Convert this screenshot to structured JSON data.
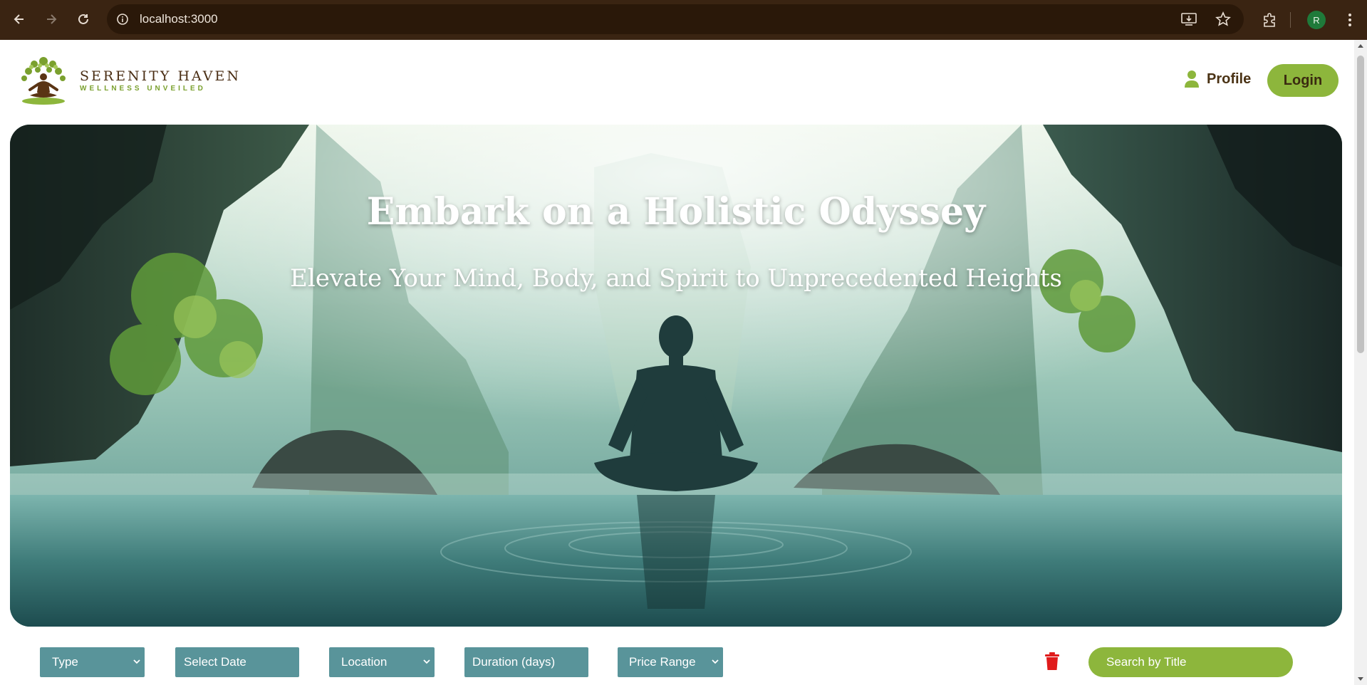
{
  "browser": {
    "url": "localhost:3000",
    "avatar_letter": "R"
  },
  "header": {
    "logo_title": "SERENITY HAVEN",
    "logo_subtitle": "WELLNESS UNVEILED",
    "profile_label": "Profile",
    "login_label": "Login"
  },
  "hero": {
    "title": "Embark on a Holistic Odyssey",
    "subtitle": "Elevate Your Mind, Body, and Spirit to Unprecedented Heights"
  },
  "filters": {
    "type": "Type",
    "date": "Select Date",
    "location": "Location",
    "duration": "Duration (days)",
    "price": "Price Range",
    "search_placeholder": "Search by Title"
  },
  "colors": {
    "accent_green": "#8db63c",
    "filter_teal": "#59949a",
    "brand_brown": "#4a2e14",
    "delete_red": "#e01b1b",
    "chrome_bg": "#3a2412"
  }
}
